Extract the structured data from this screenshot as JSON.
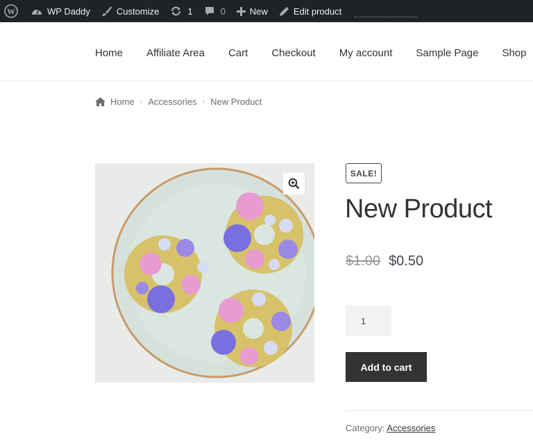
{
  "admin_bar": {
    "site_name": "WP Daddy",
    "customize": "Customize",
    "updates_count": "1",
    "comments_count": "0",
    "new_label": "New",
    "edit_label": "Edit product"
  },
  "nav": {
    "items": [
      "Home",
      "Affiliate Area",
      "Cart",
      "Checkout",
      "My account",
      "Sample Page",
      "Shop"
    ]
  },
  "breadcrumb": {
    "items": [
      "Home",
      "Accessories",
      "New Product"
    ],
    "separator": "›"
  },
  "product": {
    "sale_badge": "SALE!",
    "title": "New Product",
    "old_price": "$1.00",
    "price": "$0.50",
    "quantity": "1",
    "add_to_cart": "Add to cart",
    "category_label": "Category:",
    "category": "Accessories"
  },
  "icons": {
    "wordpress": "wordpress-icon",
    "dashboard": "dashboard-icon",
    "customize": "brush-icon",
    "updates": "refresh-icon",
    "comments": "comment-icon",
    "new": "plus-icon",
    "edit": "pencil-icon",
    "home": "home-icon",
    "zoom": "zoom-in-icon"
  },
  "colors": {
    "admin_bar_bg": "#1d2327",
    "button_bg": "#333333",
    "text": "#43454b"
  }
}
